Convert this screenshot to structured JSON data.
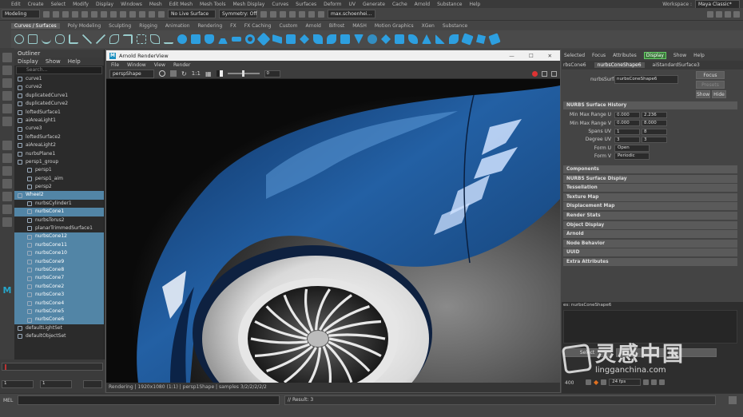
{
  "menubar": {
    "items": [
      "Edit",
      "Create",
      "Select",
      "Modify",
      "Display",
      "Windows",
      "Mesh",
      "Edit Mesh",
      "Mesh Tools",
      "Mesh Display",
      "Curves",
      "Surfaces",
      "Deform",
      "UV",
      "Generate",
      "Cache",
      "Arnold",
      "Substance",
      "Help"
    ],
    "workspace_label": "Workspace :",
    "workspace_value": "Maya Classic*"
  },
  "statusline": {
    "mode": "Modeling",
    "live_surface": "No Live Surface",
    "symmetry": "Symmetry: Off",
    "account": "max.schoenhei..."
  },
  "shelf": {
    "tabs": [
      "Curves / Surfaces",
      "Poly Modeling",
      "Sculpting",
      "Rigging",
      "Animation",
      "Rendering",
      "FX",
      "FX Caching",
      "Custom",
      "Arnold",
      "Bifrost",
      "MASH",
      "Motion Graphics",
      "XGen",
      "Substance"
    ]
  },
  "outliner": {
    "title": "Outliner",
    "menu": [
      "Display",
      "Show",
      "Help"
    ],
    "search_placeholder": "Search...",
    "rows": [
      {
        "label": "curve1",
        "indent": 0,
        "selected": false
      },
      {
        "label": "curve2",
        "indent": 0,
        "selected": false
      },
      {
        "label": "duplicatedCurve1",
        "indent": 0,
        "selected": false
      },
      {
        "label": "duplicatedCurve2",
        "indent": 0,
        "selected": false
      },
      {
        "label": "loftedSurface1",
        "indent": 0,
        "selected": false
      },
      {
        "label": "aiAreaLight1",
        "indent": 0,
        "selected": false
      },
      {
        "label": "curve3",
        "indent": 0,
        "selected": false
      },
      {
        "label": "loftedSurface2",
        "indent": 0,
        "selected": false
      },
      {
        "label": "aiAreaLight2",
        "indent": 0,
        "selected": false
      },
      {
        "label": "nurbsPlane1",
        "indent": 0,
        "selected": false
      },
      {
        "label": "persp1_group",
        "indent": 0,
        "selected": false
      },
      {
        "label": "persp1",
        "indent": 1,
        "selected": false
      },
      {
        "label": "persp1_aim",
        "indent": 1,
        "selected": false
      },
      {
        "label": "persp2",
        "indent": 1,
        "selected": false
      },
      {
        "label": "Wheel2",
        "indent": 0,
        "selected": true
      },
      {
        "label": "nurbsCylinder1",
        "indent": 1,
        "selected": false
      },
      {
        "label": "nurbsCone1",
        "indent": 1,
        "selected": true
      },
      {
        "label": "nurbsTorus2",
        "indent": 1,
        "selected": false
      },
      {
        "label": "planarTrimmedSurface1",
        "indent": 1,
        "selected": false
      },
      {
        "label": "nurbsCone12",
        "indent": 1,
        "selected": true
      },
      {
        "label": "nurbsCone11",
        "indent": 1,
        "selected": true
      },
      {
        "label": "nurbsCone10",
        "indent": 1,
        "selected": true
      },
      {
        "label": "nurbsCone9",
        "indent": 1,
        "selected": true
      },
      {
        "label": "nurbsCone8",
        "indent": 1,
        "selected": true
      },
      {
        "label": "nurbsCone7",
        "indent": 1,
        "selected": true
      },
      {
        "label": "nurbsCone2",
        "indent": 1,
        "selected": true
      },
      {
        "label": "nurbsCone3",
        "indent": 1,
        "selected": true
      },
      {
        "label": "nurbsCone4",
        "indent": 1,
        "selected": true
      },
      {
        "label": "nurbsCone5",
        "indent": 1,
        "selected": true
      },
      {
        "label": "nurbsCone6",
        "indent": 1,
        "selected": true
      },
      {
        "label": "defaultLightSet",
        "indent": 0,
        "selected": false
      },
      {
        "label": "defaultObjectSet",
        "indent": 0,
        "selected": false
      }
    ]
  },
  "renderview": {
    "title": "Arnold RenderView",
    "menu": [
      "File",
      "Window",
      "View",
      "Render"
    ],
    "camera": "perspShape",
    "ratio": "1:1",
    "value": "0",
    "status": "Rendering | 1920x1080 (1:1) | persp1Shape | samples 3/2/2/2/2/2"
  },
  "attribute_editor": {
    "menu": [
      "Selected",
      "Focus",
      "Attributes",
      "Display",
      "Show",
      "Help"
    ],
    "tabs": [
      "rbsCone6",
      "nurbsConeShape6",
      "aiStandardSurface3"
    ],
    "node_label": "nurbsSurface:",
    "node_value": "nurbsConeShape6",
    "focus_btn": "Focus",
    "presets_btn": "Presets",
    "show_btn": "Show",
    "hide_btn": "Hide",
    "history_header": "NURBS Surface History",
    "fields": {
      "min_max_u_label": "Min Max Range U",
      "min_u": "0.000",
      "max_u": "2.236",
      "min_max_v_label": "Min Max Range V",
      "min_v": "0.000",
      "max_v": "8.000",
      "spans_label": "Spans UV",
      "spans_u": "1",
      "spans_v": "8",
      "degree_label": "Degree UV",
      "degree_u": "3",
      "degree_v": "3",
      "form_u_label": "Form U",
      "form_u": "Open",
      "form_v_label": "Form V",
      "form_v": "Periodic"
    },
    "sections": [
      "Components",
      "NURBS Surface Display",
      "Tessellation",
      "Texture Map",
      "Displacement Map",
      "Render Stats",
      "Object Display",
      "Arnold",
      "Node Behavior",
      "UUID",
      "Extra Attributes"
    ],
    "notes_label": "es: nurbsConeShape6",
    "select_btn": "Select"
  },
  "timeline": {
    "frame_start": "1",
    "frame_current": "1",
    "frame_end": "400",
    "fps": "24 fps"
  },
  "commandline": {
    "lang": "MEL",
    "result": "// Result: 3"
  },
  "watermark": {
    "title": "灵感中国",
    "url": "lingganchina.com"
  },
  "colors": {
    "selection": "#5285a6",
    "car_paint": "#1e4f8a",
    "display_tab": "#3a7a3a"
  }
}
